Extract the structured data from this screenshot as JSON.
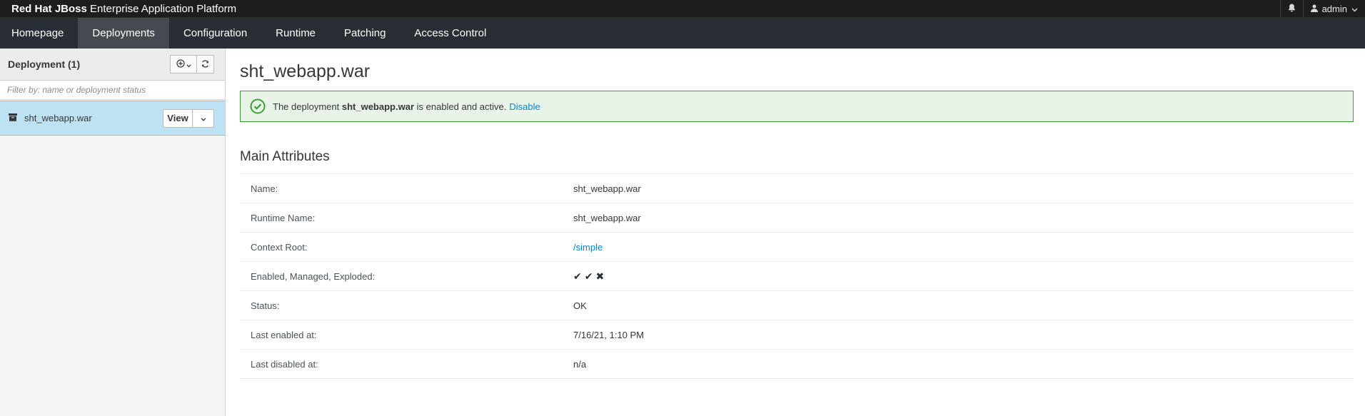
{
  "masthead": {
    "brand_bold": "Red Hat JBoss",
    "brand_rest": "Enterprise Application Platform",
    "user": "admin"
  },
  "nav": {
    "items": [
      {
        "label": "Homepage"
      },
      {
        "label": "Deployments"
      },
      {
        "label": "Configuration"
      },
      {
        "label": "Runtime"
      },
      {
        "label": "Patching"
      },
      {
        "label": "Access Control"
      }
    ],
    "active": "Deployments"
  },
  "sidebar": {
    "title": "Deployment (1)",
    "filter_placeholder": "Filter by: name or deployment status",
    "items": [
      {
        "name": "sht_webapp.war",
        "view_label": "View"
      }
    ]
  },
  "main": {
    "title": "sht_webapp.war",
    "alert": {
      "prefix": "The deployment",
      "name": "sht_webapp.war",
      "suffix": "is enabled and active.",
      "action": "Disable"
    },
    "section_title": "Main Attributes",
    "attributes": [
      {
        "label": "Name:",
        "value": "sht_webapp.war"
      },
      {
        "label": "Runtime Name:",
        "value": "sht_webapp.war"
      },
      {
        "label": "Context Root:",
        "value": "/simple"
      },
      {
        "label": "Enabled, Managed, Exploded:",
        "value": ""
      },
      {
        "label": "Status:",
        "value": "OK"
      },
      {
        "label": "Last enabled at:",
        "value": "7/16/21, 1:10 PM"
      },
      {
        "label": "Last disabled at:",
        "value": "n/a"
      }
    ],
    "flags": {
      "enabled": "✔",
      "managed": "✔",
      "exploded": "✖"
    }
  },
  "colors": {
    "masthead": "#1d1d1d",
    "navbar": "#292e34",
    "nav_active": "#454a51",
    "selected_row": "#bee1f4",
    "alert_bg": "#e9f4e9",
    "alert_border": "#3f9c35",
    "link": "#0088ce"
  }
}
